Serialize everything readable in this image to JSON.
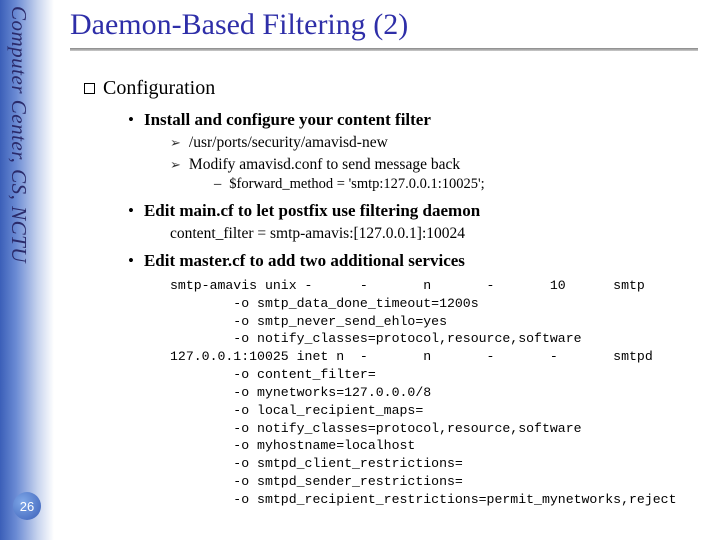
{
  "sidebar": {
    "label": "Computer Center, CS, NCTU",
    "page_number": "26"
  },
  "title": "Daemon-Based Filtering (2)",
  "section": {
    "heading": "Configuration",
    "items": [
      {
        "label": "Install and configure your content filter",
        "sub": [
          {
            "text": "/usr/ports/security/amavisd-new"
          },
          {
            "text": "Modify amavisd.conf to send message back",
            "sub": [
              {
                "text": "$forward_method = 'smtp:127.0.0.1:10025';"
              }
            ]
          }
        ]
      },
      {
        "label": "Edit main.cf to let postfix use filtering daemon",
        "body": "content_filter = smtp-amavis:[127.0.0.1]:10024"
      },
      {
        "label": "Edit master.cf to add two additional services",
        "code": "smtp-amavis unix -      -       n       -       10      smtp\n        -o smtp_data_done_timeout=1200s\n        -o smtp_never_send_ehlo=yes\n        -o notify_classes=protocol,resource,software\n127.0.0.1:10025 inet n  -       n       -       -       smtpd\n        -o content_filter=\n        -o mynetworks=127.0.0.0/8\n        -o local_recipient_maps=\n        -o notify_classes=protocol,resource,software\n        -o myhostname=localhost\n        -o smtpd_client_restrictions=\n        -o smtpd_sender_restrictions=\n        -o smtpd_recipient_restrictions=permit_mynetworks,reject"
      }
    ]
  }
}
